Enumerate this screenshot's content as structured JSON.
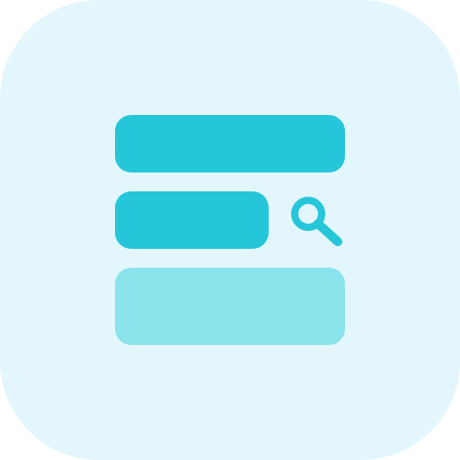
{
  "icon": {
    "name": "search-list-icon",
    "colors": {
      "tile_background": "#e2f6fb",
      "primary": "#26c6da",
      "secondary": "#8be3ec"
    },
    "parts": [
      "search-bar",
      "magnifier-icon",
      "result-block"
    ]
  }
}
